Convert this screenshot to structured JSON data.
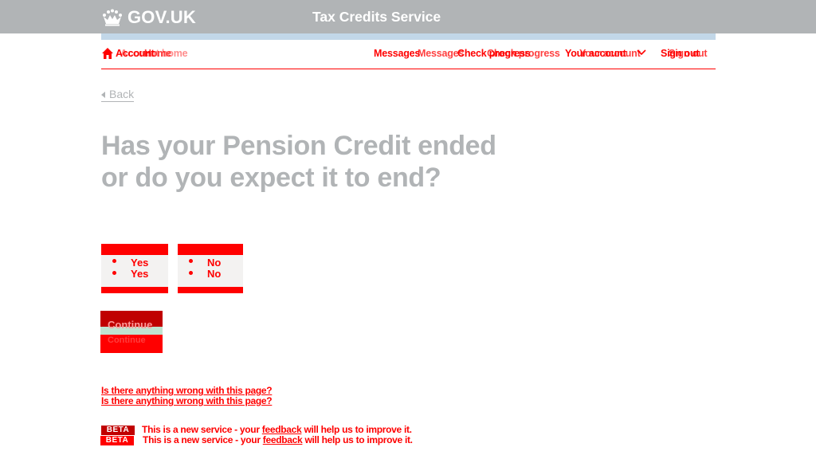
{
  "header": {
    "logo_text": "GOV.UK",
    "service_name": "Tax Credits Service"
  },
  "nav": {
    "home_labels": [
      "Account",
      "Home",
      "Account home"
    ],
    "messages_label": "Messages",
    "messages_ghost": "Messages",
    "check_progress_label": "Check progress",
    "check_progress_ghost": "Check progress",
    "your_account_label": "Your account",
    "your_account_ghost": "Your account",
    "sign_out_label": "Sign out",
    "sign_out_ghost": "Sign out"
  },
  "back": {
    "label": "Back"
  },
  "page": {
    "title": "Has your Pension Credit ended or do you expect it to end?"
  },
  "radios": [
    {
      "label": "Yes",
      "ghost": "Yes"
    },
    {
      "label": "No",
      "ghost": "No"
    }
  ],
  "continue_button": {
    "label": "Continue",
    "ghost": "Continue"
  },
  "report": {
    "link_1": "Is there anything wrong with this page?",
    "link_2": "Is there anything wrong with this page?"
  },
  "beta_banner": {
    "tag": "BETA",
    "text_before": "This is a new service - your",
    "link": "feedback",
    "text_after": "will help us to improve it."
  },
  "colors": {
    "header_bg": "#b1b4b6",
    "accent": "#ff0000",
    "blue_bar": "#c2d7e8"
  }
}
